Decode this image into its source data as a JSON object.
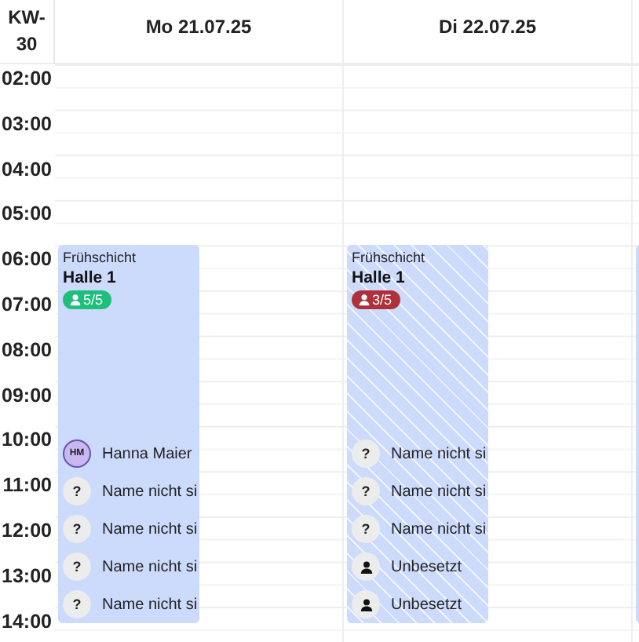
{
  "week": {
    "label": "KW-30"
  },
  "hours": [
    "02:00",
    "03:00",
    "04:00",
    "05:00",
    "06:00",
    "07:00",
    "08:00",
    "09:00",
    "10:00",
    "11:00",
    "12:00",
    "13:00",
    "14:00"
  ],
  "days": [
    {
      "label": "Mo 21.07.25",
      "shift": {
        "type": "Frühschicht",
        "place": "Halle 1",
        "count": "5/5",
        "understaffed": false,
        "assignments": [
          {
            "kind": "person",
            "initials": "HM",
            "name": "Hanna Maier"
          },
          {
            "kind": "unknown",
            "symbol": "?",
            "name": "Name nicht si"
          },
          {
            "kind": "unknown",
            "symbol": "?",
            "name": "Name nicht si"
          },
          {
            "kind": "unknown",
            "symbol": "?",
            "name": "Name nicht si"
          },
          {
            "kind": "unknown",
            "symbol": "?",
            "name": "Name nicht si"
          }
        ]
      }
    },
    {
      "label": "Di 22.07.25",
      "shift": {
        "type": "Frühschicht",
        "place": "Halle 1",
        "count": "3/5",
        "understaffed": true,
        "assignments": [
          {
            "kind": "unknown",
            "symbol": "?",
            "name": "Name nicht si"
          },
          {
            "kind": "unknown",
            "symbol": "?",
            "name": "Name nicht si"
          },
          {
            "kind": "unknown",
            "symbol": "?",
            "name": "Name nicht si"
          },
          {
            "kind": "vacant",
            "name": "Unbesetzt"
          },
          {
            "kind": "vacant",
            "name": "Unbesetzt"
          }
        ]
      }
    },
    {
      "shift": {
        "understaffed": false
      }
    }
  ]
}
